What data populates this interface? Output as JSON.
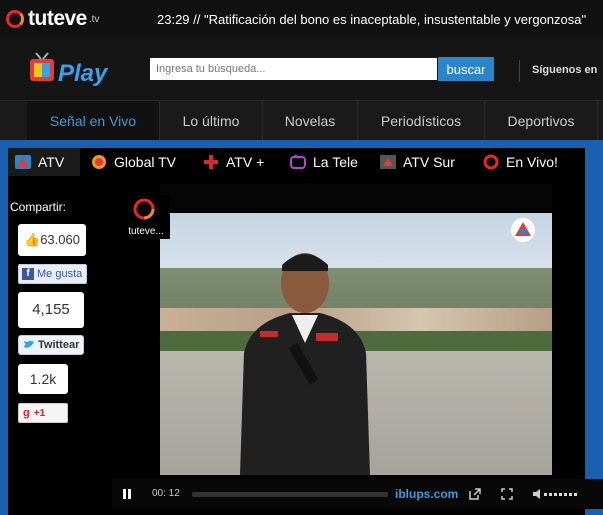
{
  "header": {
    "logo": "tuteve",
    "logo_suffix": ".tv",
    "ticker": "23:29 // \"Ratificación del bono es inaceptable, insustentable y vergonzosa\""
  },
  "search": {
    "placeholder": "Ingresa tu búsqueda...",
    "button": "buscar"
  },
  "follow_label": "Síguenos en",
  "nav": {
    "items": [
      {
        "label": "Señal en Vivo",
        "active": true
      },
      {
        "label": "Lo último"
      },
      {
        "label": "Novelas"
      },
      {
        "label": "Periodísticos"
      },
      {
        "label": "Deportivos"
      }
    ]
  },
  "channels": [
    {
      "label": "ATV",
      "active": true,
      "icon": "atv-icon"
    },
    {
      "label": "Global TV",
      "icon": "global-tv-icon"
    },
    {
      "label": "ATV +",
      "icon": "atv-plus-icon"
    },
    {
      "label": "La Tele",
      "icon": "la-tele-icon"
    },
    {
      "label": "ATV Sur",
      "icon": "atv-sur-icon"
    },
    {
      "label": "En Vivo!",
      "icon": "tuteve-icon"
    }
  ],
  "share": {
    "title": "Compartir:",
    "facebook_count": "63.060",
    "facebook_label": "Me gusta",
    "twitter_count": "4,155",
    "twitter_label": "Twittear",
    "gplus_count": "1.2k",
    "gplus_label": "+1"
  },
  "player": {
    "watermark": "tuteve...",
    "time": "00: 12",
    "brand": "iblups.com"
  },
  "colors": {
    "accent": "#3e9be0",
    "blue_bg": "#1a5fb0",
    "search_button": "#2b86c9"
  }
}
